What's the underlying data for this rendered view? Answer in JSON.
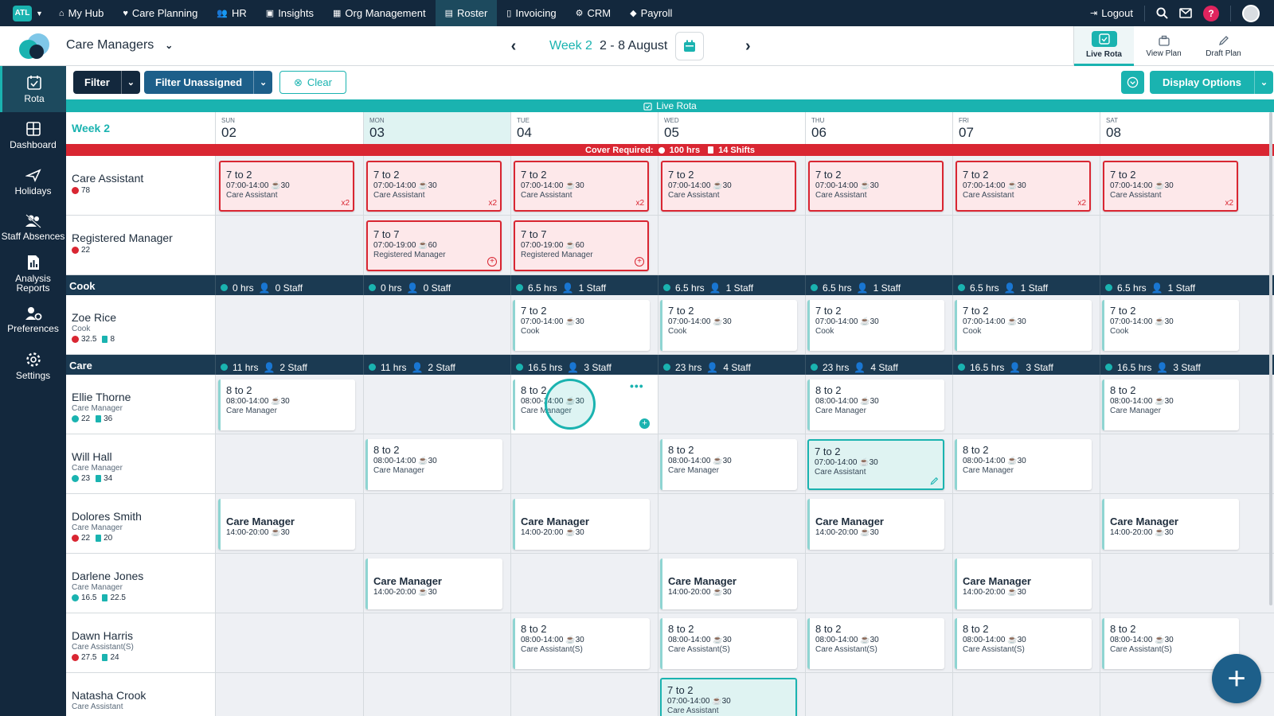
{
  "topnav": {
    "badge": "ATL",
    "items": [
      "My Hub",
      "Care Planning",
      "HR",
      "Insights",
      "Org Management",
      "Roster",
      "Invoicing",
      "CRM",
      "Payroll"
    ],
    "active": "Roster",
    "logout": "Logout",
    "help": "?"
  },
  "header": {
    "title": "Care Managers",
    "week_label": "Week 2",
    "date_range": "2 - 8 August",
    "view_tabs": [
      "Live Rota",
      "View Plan",
      "Draft Plan"
    ]
  },
  "sidebar": {
    "items": [
      "Rota",
      "Dashboard",
      "Holidays",
      "Staff Absences",
      "Analysis Reports",
      "Preferences",
      "Settings"
    ]
  },
  "toolbar": {
    "filter": "Filter",
    "filter_unassigned": "Filter Unassigned",
    "clear": "Clear",
    "display_options": "Display Options"
  },
  "banner": "Live Rota",
  "grid": {
    "week": "Week 2",
    "days": [
      {
        "name": "SUN",
        "date": "02"
      },
      {
        "name": "MON",
        "date": "03"
      },
      {
        "name": "TUE",
        "date": "04"
      },
      {
        "name": "WED",
        "date": "05"
      },
      {
        "name": "THU",
        "date": "06"
      },
      {
        "name": "FRI",
        "date": "07"
      },
      {
        "name": "SAT",
        "date": "08"
      }
    ],
    "cover": {
      "label": "Cover Required:",
      "hrs": "100 hrs",
      "shifts": "14 Shifts"
    }
  },
  "cover_rows": [
    {
      "name": "Care Assistant",
      "count": "78"
    },
    {
      "name": "Registered Manager",
      "count": "22"
    }
  ],
  "groups": {
    "cook": {
      "name": "Cook",
      "hrs": [
        "0 hrs",
        "0 hrs",
        "6.5 hrs",
        "6.5 hrs",
        "6.5 hrs",
        "6.5 hrs",
        "6.5 hrs"
      ],
      "staff": [
        "0 Staff",
        "0 Staff",
        "1 Staff",
        "1 Staff",
        "1 Staff",
        "1 Staff",
        "1 Staff"
      ]
    },
    "care": {
      "name": "Care",
      "hrs": [
        "11 hrs",
        "11 hrs",
        "16.5 hrs",
        "23 hrs",
        "23 hrs",
        "16.5 hrs",
        "16.5 hrs"
      ],
      "staff": [
        "2 Staff",
        "2 Staff",
        "3 Staff",
        "4 Staff",
        "4 Staff",
        "3 Staff",
        "3 Staff"
      ]
    }
  },
  "staff": [
    {
      "name": "Zoe Rice",
      "role": "Cook",
      "hrs": "32.5",
      "shifts": "8"
    },
    {
      "name": "Ellie Thorne",
      "role": "Care Manager",
      "hrs": "22",
      "shifts": "36"
    },
    {
      "name": "Will Hall",
      "role": "Care Manager",
      "hrs": "23",
      "shifts": "34"
    },
    {
      "name": "Dolores Smith",
      "role": "Care Manager",
      "hrs": "22",
      "shifts": "20"
    },
    {
      "name": "Darlene Jones",
      "role": "Care Manager",
      "hrs": "16.5",
      "shifts": "22.5"
    },
    {
      "name": "Dawn Harris",
      "role": "Care Assistant(S)",
      "hrs": "27.5",
      "shifts": "24"
    },
    {
      "name": "Natasha Crook",
      "role": "Care Assistant",
      "hrs": "",
      "shifts": ""
    }
  ],
  "shifts": {
    "s72ca": {
      "title": "7 to 2",
      "time": "07:00-14:00",
      "brk": "30",
      "role": "Care Assistant"
    },
    "s77rm": {
      "title": "7 to 7",
      "time": "07:00-19:00",
      "brk": "60",
      "role": "Registered Manager"
    },
    "s72cook": {
      "title": "7 to 2",
      "time": "07:00-14:00",
      "brk": "30",
      "role": "Cook"
    },
    "s82cm": {
      "title": "8 to 2",
      "time": "08:00-14:00",
      "brk": "30",
      "role": "Care Manager"
    },
    "s82cas": {
      "title": "8 to 2",
      "time": "08:00-14:00",
      "brk": "30",
      "role": "Care Assistant(S)"
    },
    "cm_late": {
      "title": "Care Manager",
      "time": "14:00-20:00",
      "brk": "30"
    },
    "x2": "x2"
  }
}
